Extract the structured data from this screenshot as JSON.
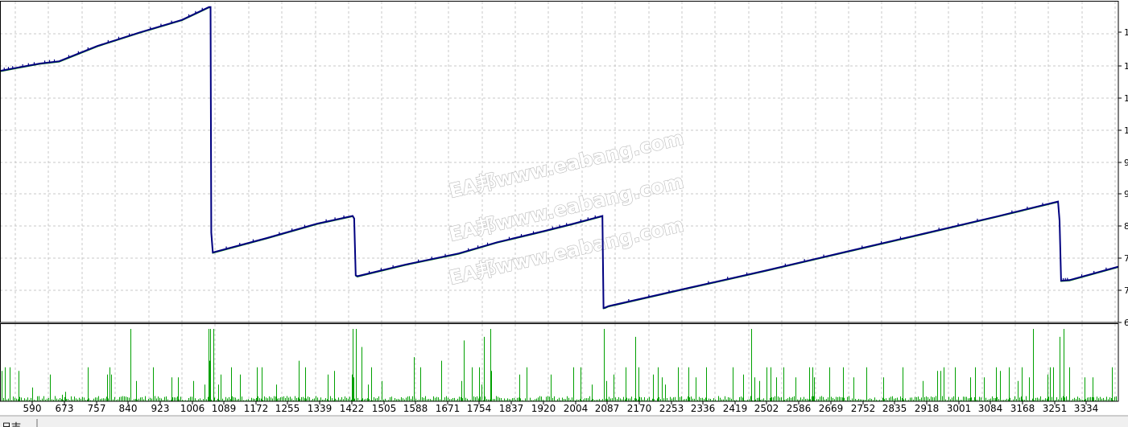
{
  "colors": {
    "background": "#ffffff",
    "grid": "#c8c8c8",
    "frame": "#000000",
    "balance_line": "#000080",
    "equity_line": "#008000",
    "volume_bars": "#00a000"
  },
  "watermark": {
    "text": "EA邦www.eabang.com",
    "copies": 3
  },
  "bottom_tab": {
    "label": "日志"
  },
  "chart_data": [
    {
      "type": "line",
      "title": "",
      "xlabel": "",
      "ylabel": "",
      "y_tick_labels_visible": [
        "1",
        "1",
        "1",
        "1",
        "9",
        "9",
        "8",
        "7",
        "7",
        "6"
      ],
      "xlim": [
        506,
        3417
      ],
      "grid": true,
      "series": [
        {
          "x": [
            506,
            550,
            610,
            660,
            760,
            870,
            980,
            1050,
            1054,
            1056,
            1060,
            1200,
            1332,
            1424,
            1428,
            1432,
            1436,
            1560,
            1700,
            1800,
            1926,
            1999,
            2074,
            2077,
            2081,
            2090,
            2300,
            2500,
            2700,
            2900,
            3100,
            3260,
            3264,
            3268,
            3290,
            3417
          ],
          "y": [
            13.84,
            13.94,
            14.07,
            14.14,
            14.62,
            15.04,
            15.43,
            15.83,
            15.83,
            8.8,
            8.18,
            8.63,
            9.08,
            9.32,
            9.24,
            7.47,
            7.44,
            7.8,
            8.15,
            8.5,
            8.86,
            9.08,
            9.32,
            6.45,
            6.46,
            6.51,
            7.08,
            7.62,
            8.18,
            8.74,
            9.3,
            9.77,
            9.17,
            7.3,
            7.32,
            7.74
          ]
        }
      ]
    },
    {
      "type": "bar",
      "title": "",
      "xlabel": "",
      "ylabel": "",
      "x_tick_labels": [
        "590",
        "673",
        "757",
        "840",
        "923",
        "1006",
        "1089",
        "1172",
        "1255",
        "1339",
        "1422",
        "1505",
        "1588",
        "1671",
        "1754",
        "1837",
        "1920",
        "2004",
        "2087",
        "2170",
        "2253",
        "2336",
        "2419",
        "2502",
        "2586",
        "2669",
        "2752",
        "2835",
        "2918",
        "3001",
        "3084",
        "3168",
        "3251",
        "3334"
      ],
      "xlim": [
        506,
        3417
      ],
      "ylim": [
        0,
        100
      ],
      "spikes": {
        "x": [
          510,
          518,
          531,
          555,
          590,
          635,
          667,
          675,
          735,
          784,
          790,
          796,
          845,
          860,
          905,
          952,
          970,
          1010,
          1038,
          1048,
          1050,
          1054,
          1061,
          1074,
          1081,
          1107,
          1130,
          1175,
          1188,
          1224,
          1283,
          1301,
          1360,
          1375,
          1421,
          1423,
          1425,
          1433,
          1448,
          1463,
          1472,
          1500,
          1583,
          1600,
          1655,
          1707,
          1714,
          1734,
          1753,
          1760,
          1766,
          1782,
          1784,
          1858,
          1877,
          1939,
          1999,
          2018,
          2046,
          2077,
          2084,
          2102,
          2135,
          2160,
          2168,
          2205,
          2218,
          2228,
          2238,
          2271,
          2297,
          2316,
          2345,
          2413,
          2441,
          2462,
          2470,
          2482,
          2501,
          2511,
          2526,
          2546,
          2577,
          2612,
          2621,
          2625,
          2664,
          2701,
          2727,
          2760,
          2806,
          2855,
          2907,
          2945,
          2953,
          2963,
          2992,
          3032,
          3045,
          3066,
          3098,
          3108,
          3131,
          3155,
          3166,
          3185,
          3195,
          3232,
          3238,
          3248,
          3264,
          3274,
          3290,
          3330,
          3350,
          3400
        ],
        "y": [
          42,
          47,
          47,
          42,
          19,
          37,
          9,
          13,
          47,
          37,
          47,
          37,
          100,
          28,
          47,
          33,
          33,
          28,
          23,
          100,
          56,
          100,
          100,
          23,
          37,
          47,
          37,
          47,
          47,
          23,
          56,
          47,
          37,
          42,
          37,
          100,
          33,
          100,
          75,
          23,
          47,
          28,
          61,
          47,
          56,
          28,
          84,
          47,
          47,
          23,
          89,
          100,
          42,
          37,
          47,
          37,
          47,
          47,
          23,
          100,
          28,
          37,
          47,
          89,
          47,
          37,
          47,
          33,
          23,
          47,
          47,
          33,
          47,
          47,
          37,
          100,
          33,
          28,
          47,
          47,
          33,
          47,
          33,
          47,
          47,
          33,
          47,
          47,
          33,
          47,
          33,
          47,
          28,
          42,
          42,
          47,
          47,
          33,
          47,
          33,
          47,
          42,
          47,
          28,
          47,
          33,
          100,
          37,
          47,
          47,
          89,
          100,
          47,
          33,
          33,
          47
        ],
        "noise_band_max": 9
      }
    }
  ]
}
